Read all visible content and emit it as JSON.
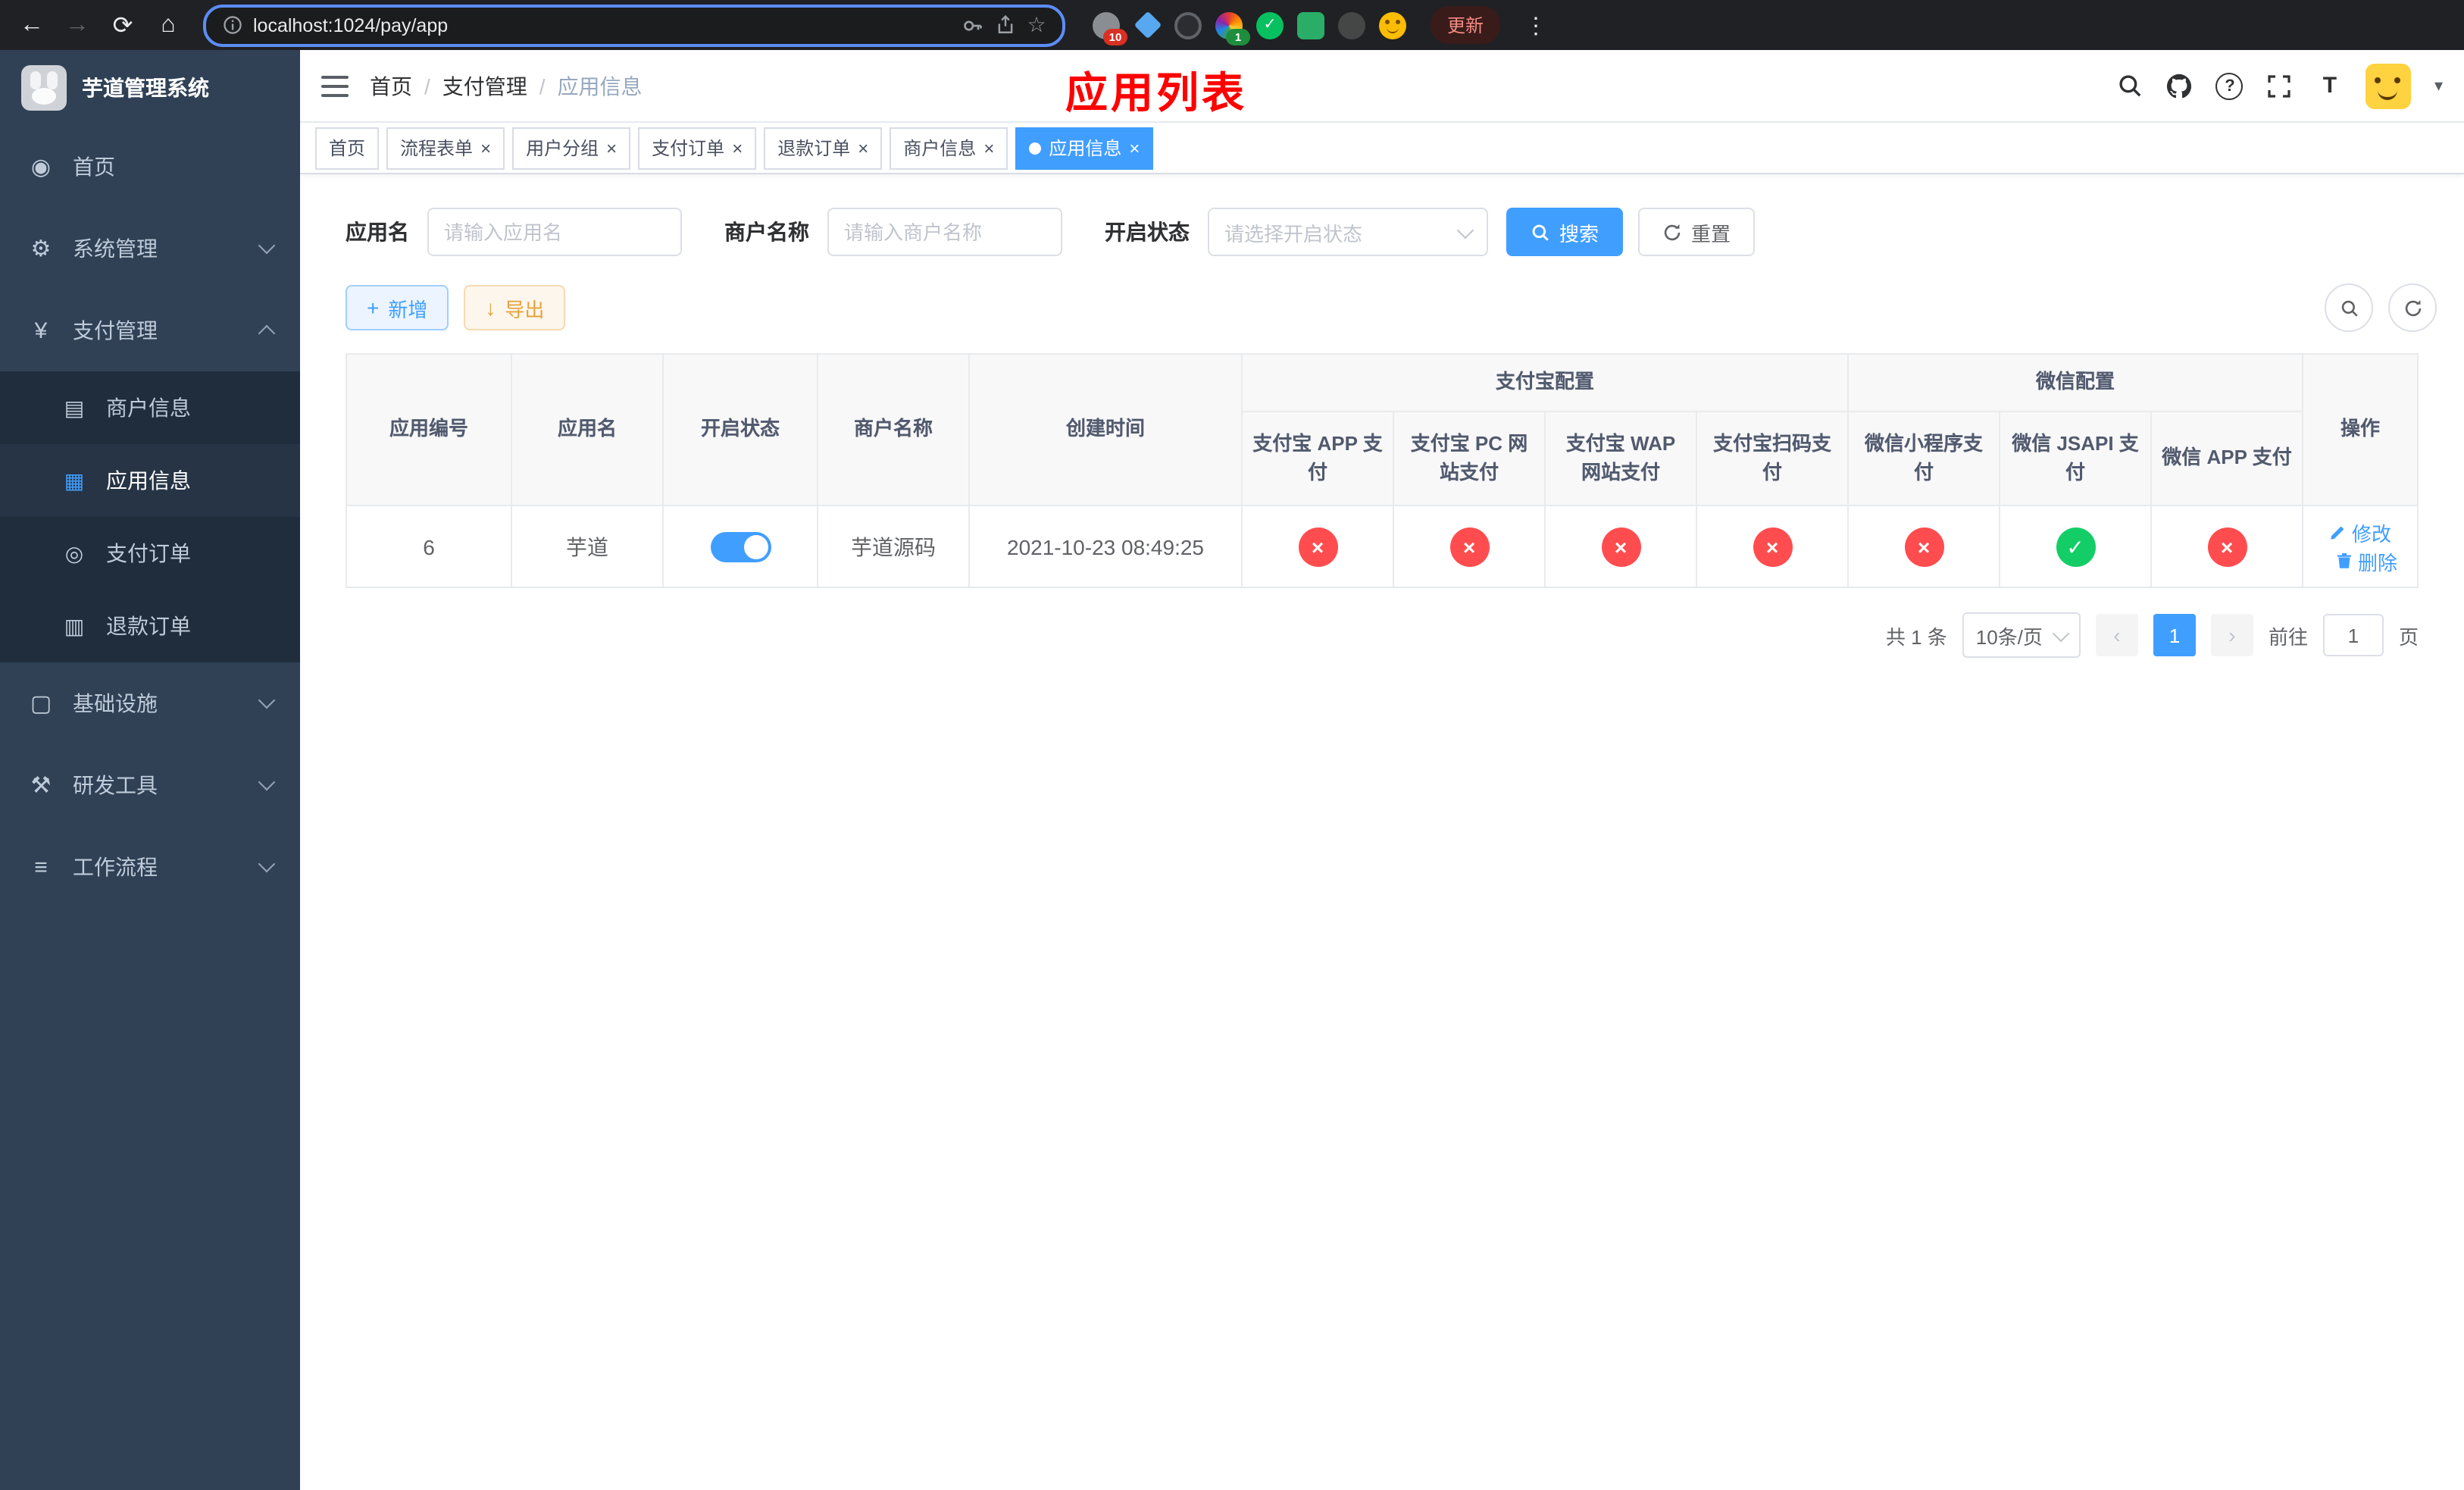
{
  "browser": {
    "url": "localhost:1024/pay/app",
    "update_label": "更新",
    "extension_badge_1": "10",
    "extension_badge_2": "1"
  },
  "sidebar": {
    "logo_title": "芋道管理系统",
    "items": [
      {
        "icon": "◉",
        "label": "首页"
      },
      {
        "icon": "⚙",
        "label": "系统管理"
      },
      {
        "icon": "¥",
        "label": "支付管理"
      },
      {
        "icon": "▤",
        "label": "商户信息"
      },
      {
        "icon": "▦",
        "label": "应用信息"
      },
      {
        "icon": "◎",
        "label": "支付订单"
      },
      {
        "icon": "▥",
        "label": "退款订单"
      },
      {
        "icon": "▢",
        "label": "基础设施"
      },
      {
        "icon": "⚒",
        "label": "研发工具"
      },
      {
        "icon": "≡",
        "label": "工作流程"
      }
    ]
  },
  "navbar": {
    "breadcrumb": [
      "首页",
      "支付管理",
      "应用信息"
    ],
    "separator": "/",
    "page_title_overlay": "应用列表"
  },
  "tabs": [
    {
      "label": "首页"
    },
    {
      "label": "流程表单"
    },
    {
      "label": "用户分组"
    },
    {
      "label": "支付订单"
    },
    {
      "label": "退款订单"
    },
    {
      "label": "商户信息"
    },
    {
      "label": "应用信息"
    }
  ],
  "filters": {
    "app_name_label": "应用名",
    "app_name_placeholder": "请输入应用名",
    "merchant_label": "商户名称",
    "merchant_placeholder": "请输入商户名称",
    "status_label": "开启状态",
    "status_placeholder": "请选择开启状态",
    "search_label": "搜索",
    "reset_label": "重置"
  },
  "toolbar": {
    "add_label": "新增",
    "export_label": "导出"
  },
  "table": {
    "group_headers": {
      "alipay": "支付宝配置",
      "wechat": "微信配置"
    },
    "columns": [
      "应用编号",
      "应用名",
      "开启状态",
      "商户名称",
      "创建时间",
      "支付宝 APP 支付",
      "支付宝 PC 网站支付",
      "支付宝 WAP 网站支付",
      "支付宝扫码支付",
      "微信小程序支付",
      "微信 JSAPI 支付",
      "微信 APP 支付",
      "操作"
    ],
    "rows": [
      {
        "id": "6",
        "name": "芋道",
        "enabled": true,
        "merchant": "芋道源码",
        "created": "2021-10-23 08:49:25",
        "alipay_app": false,
        "alipay_pc": false,
        "alipay_wap": false,
        "alipay_scan": false,
        "wechat_mini": false,
        "wechat_jsapi": true,
        "wechat_app": false,
        "edit_label": "修改",
        "delete_label": "删除"
      }
    ]
  },
  "pagination": {
    "total_text": "共 1 条",
    "page_size": "10条/页",
    "current_page": "1",
    "goto_prefix": "前往",
    "goto_value": "1",
    "goto_suffix": "页"
  },
  "icons": {
    "back": "←",
    "forward": "→",
    "reload": "⟳",
    "home": "⌂",
    "star": "☆",
    "kebab": "⋮",
    "caret": "▾",
    "question": "?",
    "font_resize": "T",
    "close": "×",
    "check": "✓",
    "cross": "×",
    "plus": "+",
    "download": "↓",
    "prev": "‹",
    "next": "›"
  },
  "colors": {
    "primary": "#409EFF",
    "success": "#13ce66",
    "danger": "#ff4d4f"
  }
}
